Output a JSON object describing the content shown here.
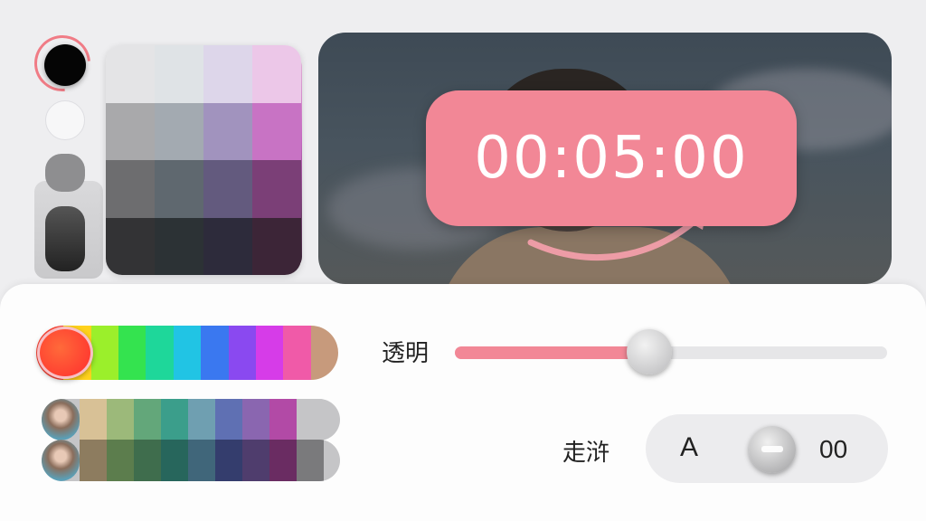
{
  "colors": {
    "accent": "#f28796",
    "sheet": "#fdfdfd",
    "knob": "#b9b9bb"
  },
  "left_chips": [
    {
      "name": "black",
      "color": "#050505",
      "selected": true
    },
    {
      "name": "white",
      "color": "#f7f7f8"
    },
    {
      "name": "gray",
      "color": "#8e8e90"
    },
    {
      "name": "dark-gray",
      "color": "#333333"
    }
  ],
  "swatch_grid": [
    [
      "#e4e4e6",
      "#dfe3e6",
      "#ddd6ea",
      "#ecc7e8"
    ],
    [
      "#a9a9ab",
      "#a3aab1",
      "#a193be",
      "#c873c4"
    ],
    [
      "#6d6d6f",
      "#5f686f",
      "#635a7e",
      "#7b3f77"
    ],
    [
      "#333335",
      "#2c3235",
      "#2d2b3b",
      "#3c2537"
    ]
  ],
  "preview": {
    "timer": "00:05:00"
  },
  "hue_bar": {
    "colors": [
      "#ff4a3a",
      "#ffd21c",
      "#9bef2b",
      "#34e34f",
      "#1ed79a",
      "#21c4e4",
      "#3a78f0",
      "#8a49f0",
      "#d63ce8",
      "#f05aa8",
      "#c79a7c"
    ]
  },
  "photo_rows": [
    [
      "#d8c196",
      "#9cb97a",
      "#63a77a",
      "#3b9e8b",
      "#6f9fb1",
      "#5f70b3",
      "#8a66b0",
      "#b24aa6",
      "#c5c5c7"
    ],
    [
      "#8d7c5f",
      "#5c7d4d",
      "#3f6d4d",
      "#27665c",
      "#40667a",
      "#343d6d",
      "#4f3d6d",
      "#6a2c62",
      "#7a7a7c"
    ]
  ],
  "controls": {
    "opacity_label": "透明",
    "opacity_value": 0.45,
    "run_label": "走浒",
    "stepper_letter": "A",
    "stepper_value": "00"
  }
}
